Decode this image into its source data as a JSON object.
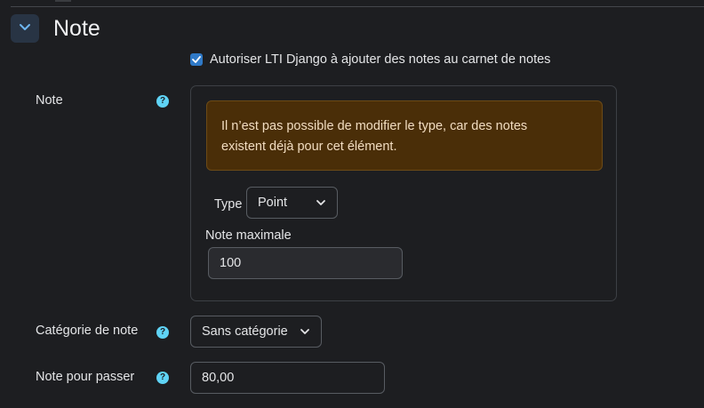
{
  "section": {
    "title": "Note"
  },
  "allow_grades": {
    "label": "Autoriser LTI Django à ajouter des notes au carnet de notes",
    "checked": true
  },
  "grade": {
    "label": "Note",
    "help_icon": "question-circle-icon",
    "alert_text_line1": "Il n’est pas possible de modifier le type, car des notes",
    "alert_text_line2": "existent déjà pour cet élément.",
    "type_label": "Type",
    "type_value": "Point",
    "max_label": "Note maximale",
    "max_value": "100"
  },
  "category": {
    "label": "Catégorie de note",
    "value": "Sans catégorie"
  },
  "pass": {
    "label": "Note pour passer",
    "value": "80,00"
  },
  "colors": {
    "background": "#1d1e21",
    "accent": "#2f79c7",
    "help": "#5fd3f5",
    "alert_bg": "#4a2e08",
    "alert_text": "#f1dcc0"
  }
}
